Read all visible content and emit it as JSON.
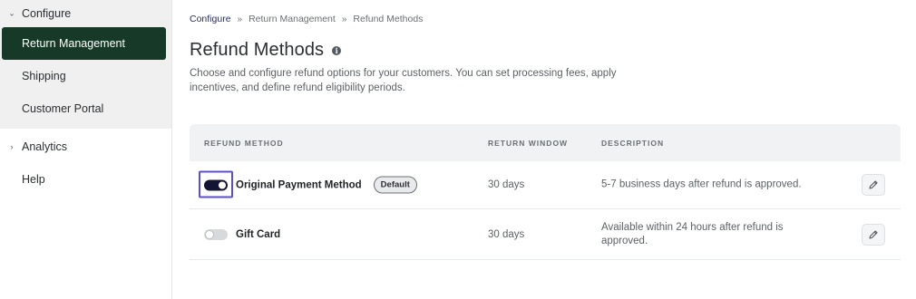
{
  "sidebar": {
    "configure_label": "Configure",
    "items": [
      {
        "label": "Return Management"
      },
      {
        "label": "Shipping"
      },
      {
        "label": "Customer Portal"
      }
    ],
    "analytics_label": "Analytics",
    "help_label": "Help"
  },
  "breadcrumb": {
    "items": [
      "Configure",
      "Return Management",
      "Refund Methods"
    ],
    "separator": "»"
  },
  "page": {
    "title": "Refund Methods",
    "description": "Choose and configure refund options for your customers. You can set processing fees, apply incentives, and define refund eligibility periods."
  },
  "table": {
    "headers": {
      "method": "REFUND METHOD",
      "window": "RETURN WINDOW",
      "description": "DESCRIPTION"
    },
    "rows": [
      {
        "method": "Original Payment Method",
        "enabled": true,
        "badge": "Default",
        "window": "30 days",
        "description": "5-7 business days after refund is approved."
      },
      {
        "method": "Gift Card",
        "enabled": false,
        "badge": "",
        "window": "30 days",
        "description": "Available within 24 hours after refund is approved."
      }
    ]
  },
  "colors": {
    "accent": "#173a28",
    "toggle_on": "#141433",
    "focus_ring": "#5b4be0"
  }
}
